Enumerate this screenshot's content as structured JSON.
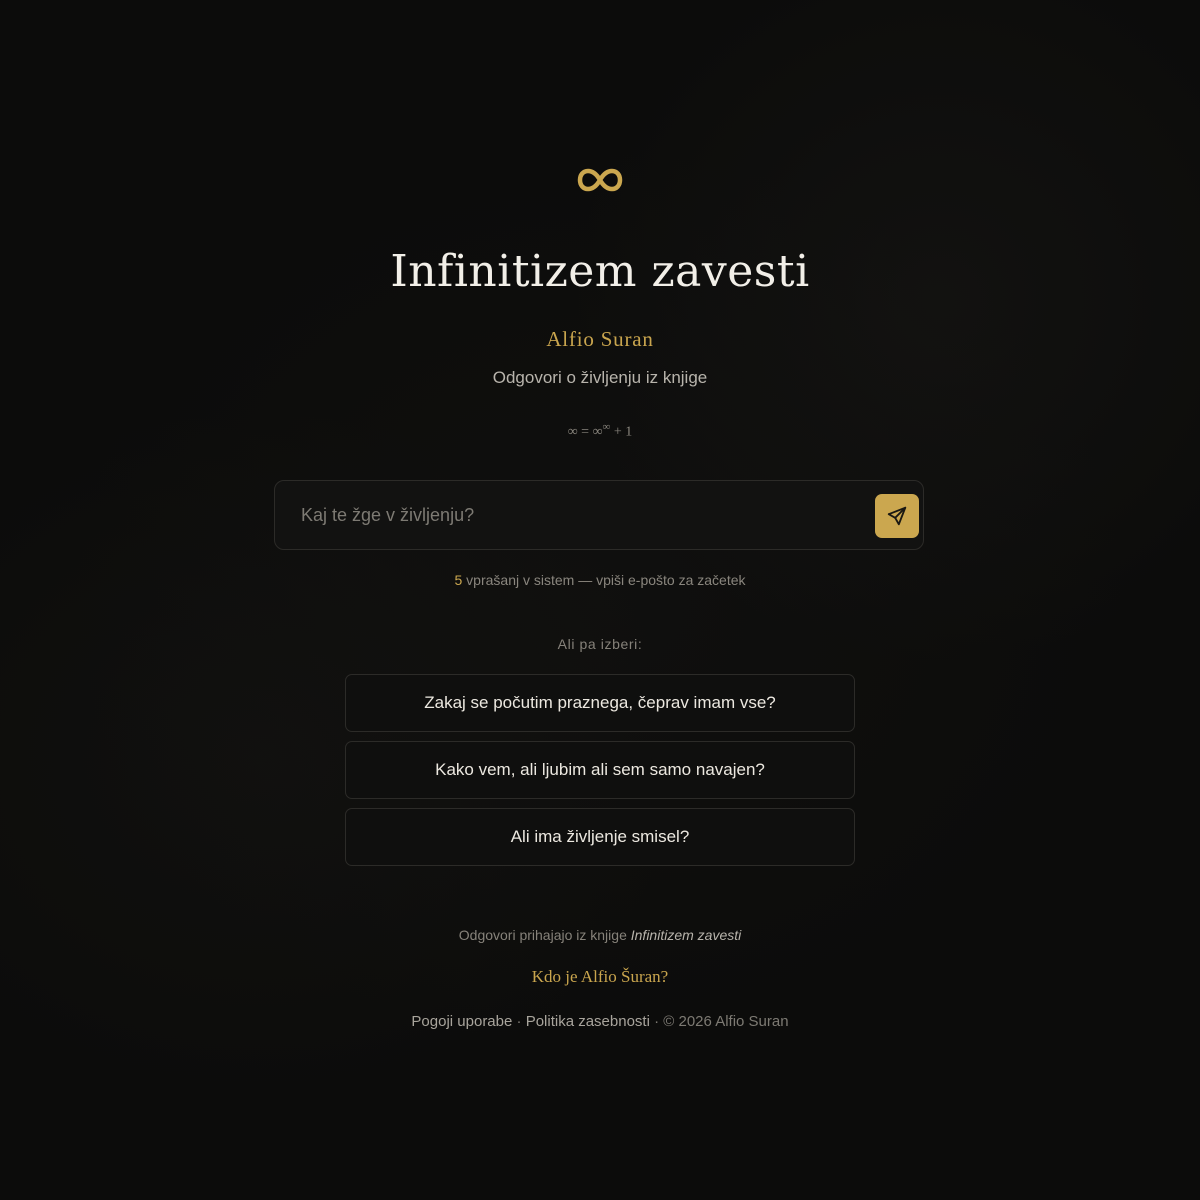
{
  "header": {
    "logo_icon": "infinity-icon",
    "title": "Infinitizem zavesti",
    "author": "Alfio Suran",
    "subtitle": "Odgovori o življenju iz knjige",
    "formula": {
      "base": "∞ = ∞",
      "superscript": "∞",
      "tail": " + 1"
    }
  },
  "search": {
    "placeholder": "Kaj te žge v življenju?",
    "value": "",
    "send_icon": "send-icon"
  },
  "counter": {
    "count": "5",
    "text": " vprašanj v sistem — vpiši e-pošto za začetek"
  },
  "suggestions": {
    "label": "Ali pa izberi:",
    "items": [
      "Zakaj se počutim praznega, čeprav imam vse?",
      "Kako vem, ali ljubim ali sem samo navajen?",
      "Ali ima življenje smisel?"
    ]
  },
  "source": {
    "prefix": "Odgovori prihajajo iz knjige ",
    "book": "Infinitizem zavesti"
  },
  "about_link": "Kdo je Alfio Šuran?",
  "footer": {
    "terms": "Pogoji uporabe",
    "separator1": " · ",
    "privacy": "Politika zasebnosti",
    "separator2": " · ",
    "copyright": "© 2026 Alfio Suran"
  },
  "colors": {
    "accent": "#cba74f",
    "background": "#0c0c0b"
  }
}
